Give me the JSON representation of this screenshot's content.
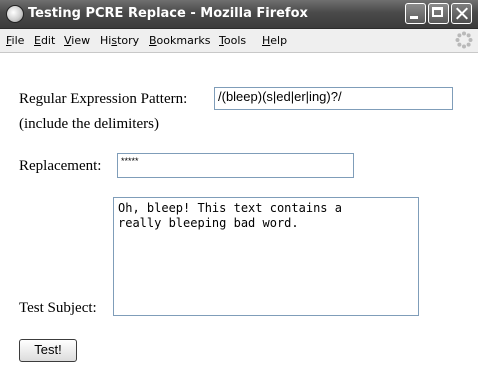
{
  "window": {
    "title": "Testing PCRE Replace - Mozilla Firefox"
  },
  "menu": {
    "items": [
      {
        "key": "F",
        "rest": "ile"
      },
      {
        "key": "E",
        "rest": "dit"
      },
      {
        "key": "V",
        "rest": "iew"
      },
      {
        "pre": "Hi",
        "key": "s",
        "rest": "tory"
      },
      {
        "key": "B",
        "rest": "ookmarks"
      },
      {
        "key": "T",
        "rest": "ools"
      },
      {
        "key": "H",
        "rest": "elp"
      }
    ]
  },
  "form": {
    "pattern_label": "Regular Expression Pattern:",
    "pattern_value": "/(bleep)(s|ed|er|ing)?/",
    "delimiter_note": "(include the delimiters)",
    "replacement_label": "Replacement:",
    "replacement_value": "*****",
    "subject_label": "Test Subject:",
    "subject_line1": "Oh, bleep! This text contains a",
    "subject_line2": "really bleeping bad word.",
    "submit_label": "Test!"
  }
}
